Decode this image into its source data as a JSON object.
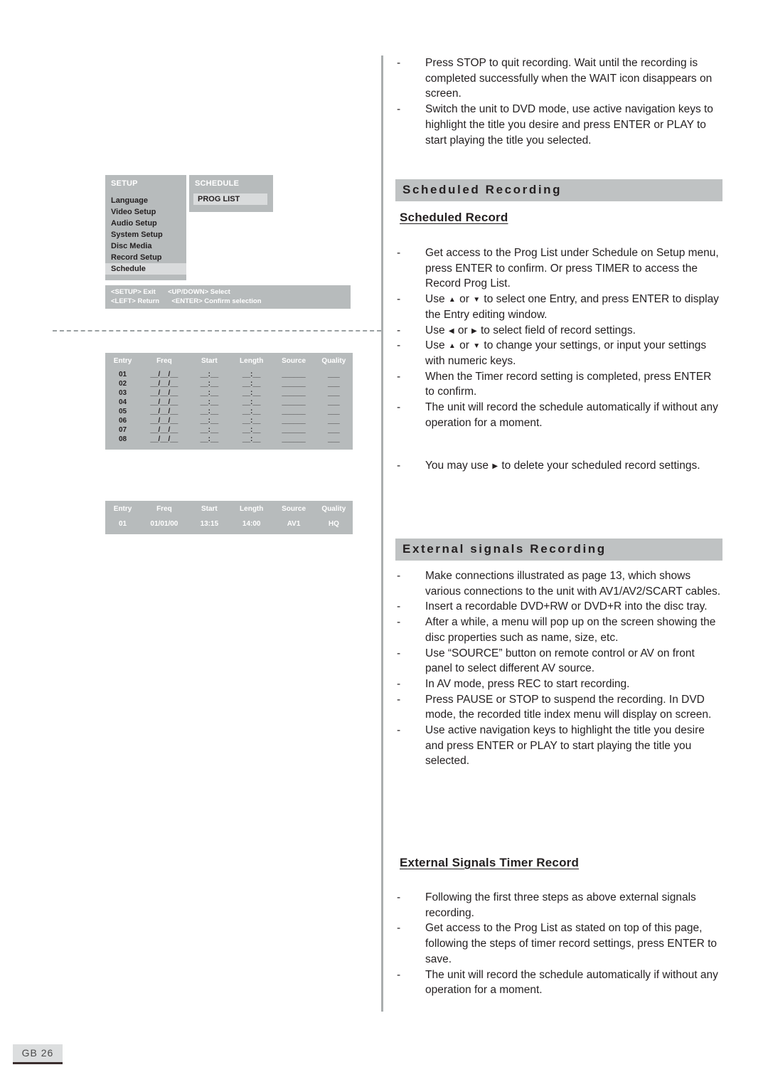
{
  "page": {
    "footer_label": "GB 26"
  },
  "osd": {
    "setup": {
      "title": "SETUP",
      "items": [
        "Language",
        "Video Setup",
        "Audio Setup",
        "System Setup",
        "Disc Media",
        "Record Setup",
        "Schedule"
      ],
      "selected_index": 6
    },
    "schedule": {
      "title": "SCHEDULE",
      "selected_item": "PROG LIST"
    },
    "hints": {
      "line1_a": "<SETUP> Exit",
      "line1_b": "<UP/DOWN> Select",
      "line2_a": "<LEFT> Return",
      "line2_b": "<ENTER> Confirm selection"
    }
  },
  "prog_list_empty": {
    "columns": [
      "Entry",
      "Freq",
      "Start",
      "Length",
      "Source",
      "Quality"
    ],
    "rows": [
      {
        "entry": "01",
        "freq": "__/__/__",
        "start": "__:__",
        "length": "__:__",
        "source": "______",
        "quality": "___"
      },
      {
        "entry": "02",
        "freq": "__/__/__",
        "start": "__:__",
        "length": "__:__",
        "source": "______",
        "quality": "___"
      },
      {
        "entry": "03",
        "freq": "__/__/__",
        "start": "__:__",
        "length": "__:__",
        "source": "______",
        "quality": "___"
      },
      {
        "entry": "04",
        "freq": "__/__/__",
        "start": "__:__",
        "length": "__:__",
        "source": "______",
        "quality": "___"
      },
      {
        "entry": "05",
        "freq": "__/__/__",
        "start": "__:__",
        "length": "__:__",
        "source": "______",
        "quality": "___"
      },
      {
        "entry": "06",
        "freq": "__/__/__",
        "start": "__:__",
        "length": "__:__",
        "source": "______",
        "quality": "___"
      },
      {
        "entry": "07",
        "freq": "__/__/__",
        "start": "__:__",
        "length": "__:__",
        "source": "______",
        "quality": "___"
      },
      {
        "entry": "08",
        "freq": "__/__/__",
        "start": "__:__",
        "length": "__:__",
        "source": "______",
        "quality": "___"
      }
    ]
  },
  "prog_list_filled": {
    "columns": [
      "Entry",
      "Freq",
      "Start",
      "Length",
      "Source",
      "Quality"
    ],
    "rows": [
      {
        "entry": "01",
        "freq": "01/01/00",
        "start": "13:15",
        "length": "14:00",
        "source": "AV1",
        "quality": "HQ"
      }
    ]
  },
  "content": {
    "top_bullets": [
      "Press STOP to quit recording. Wait until the recording is completed successfully when the WAIT icon disappears on screen.",
      "Switch the unit to DVD mode, use active navigation keys to highlight the title you desire and press ENTER or PLAY to start playing the title you selected."
    ],
    "scheduled_recording": {
      "band": "Scheduled Recording",
      "subhead": "Scheduled Record",
      "bullets": [
        {
          "parts": [
            {
              "t": "Get access to the Prog List under Schedule on Setup menu, press ENTER to confirm. Or press TIMER to access the Record Prog List."
            }
          ]
        },
        {
          "parts": [
            {
              "t": "Use "
            },
            {
              "arrow": "up"
            },
            {
              "t": " or "
            },
            {
              "arrow": "down"
            },
            {
              "t": " to select one Entry, and press ENTER to display the Entry editing window."
            }
          ]
        },
        {
          "parts": [
            {
              "t": "Use "
            },
            {
              "arrow": "left"
            },
            {
              "t": " or "
            },
            {
              "arrow": "right"
            },
            {
              "t": " to select field of record settings."
            }
          ]
        },
        {
          "parts": [
            {
              "t": "Use "
            },
            {
              "arrow": "up"
            },
            {
              "t": " or "
            },
            {
              "arrow": "down"
            },
            {
              "t": " to change your settings, or input your settings with numeric keys."
            }
          ]
        },
        {
          "parts": [
            {
              "t": "When the Timer record setting is completed, press ENTER to confirm."
            }
          ]
        },
        {
          "parts": [
            {
              "t": "The unit will record the schedule automatically if without any operation for a moment."
            }
          ]
        }
      ],
      "delete_bullet": {
        "parts": [
          {
            "t": "You may use "
          },
          {
            "arrow": "right"
          },
          {
            "t": " to delete your scheduled record settings."
          }
        ]
      }
    },
    "external_signals_recording": {
      "band": "External signals Recording",
      "bullets": [
        "Make connections illustrated as page 13, which shows various connections to the unit with AV1/AV2/SCART cables.",
        "Insert a recordable DVD+RW or DVD+R into the disc tray.",
        "After a while, a menu will pop up on the screen showing the disc properties such as name, size, etc.",
        "Use “SOURCE” button on remote control or AV on front panel to select different AV source.",
        "In AV mode, press REC to start recording.",
        "Press PAUSE or STOP to suspend the recording. In DVD mode, the recorded title index menu will display on screen.",
        "Use active navigation keys to highlight the title you desire and press ENTER or PLAY to start playing the title you selected."
      ]
    },
    "external_signals_timer_record": {
      "subhead": "External Signals Timer Record",
      "bullets": [
        "Following the first three steps as above external signals recording.",
        "Get access to the Prog List as stated on top of this page, following the steps of timer record settings, press ENTER to save.",
        "The unit will record the schedule automatically if without any operation for a moment."
      ]
    }
  }
}
